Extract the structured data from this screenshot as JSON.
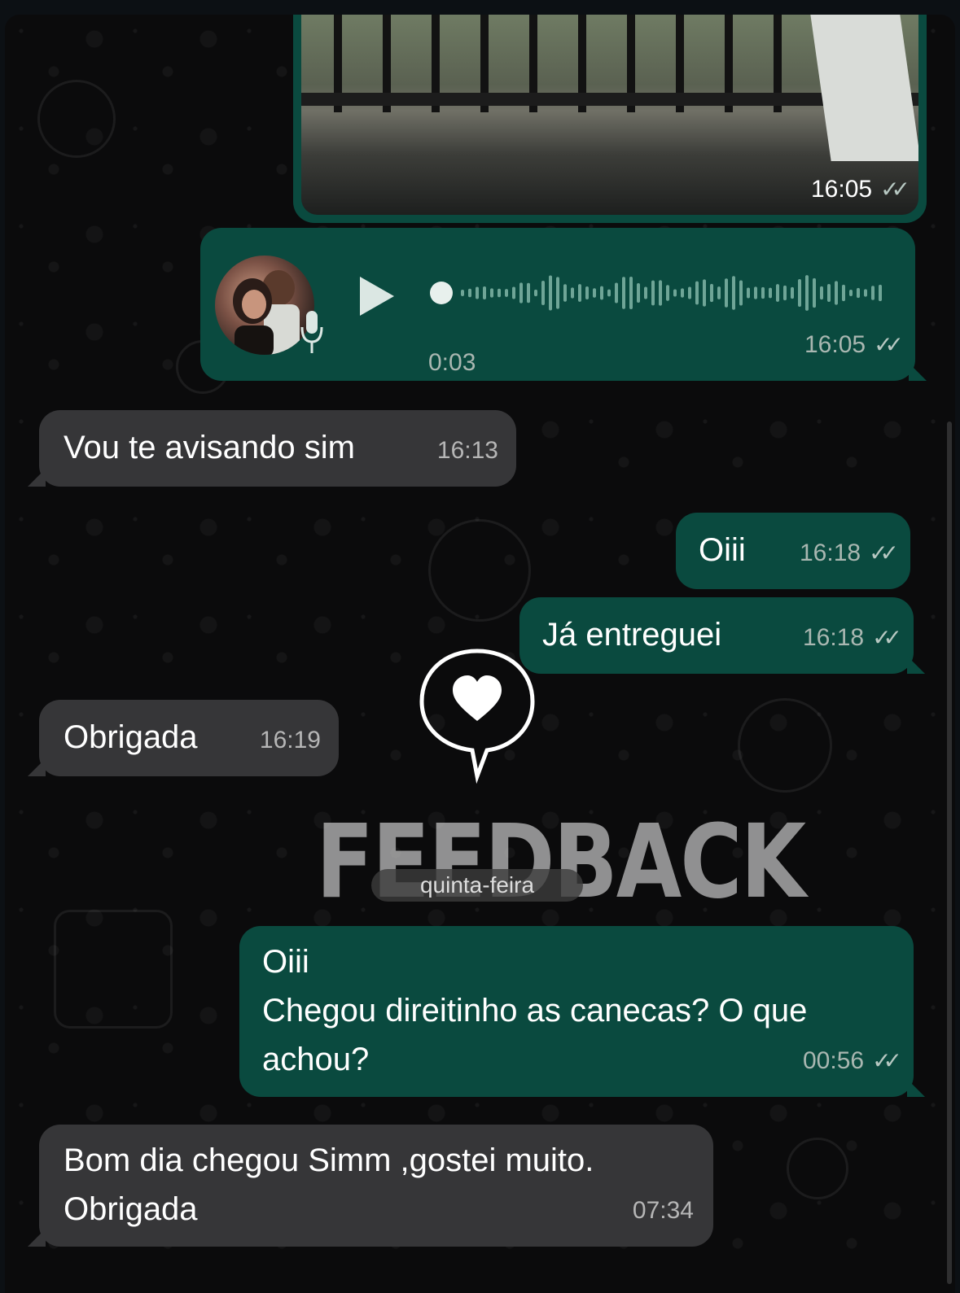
{
  "messages": [
    {
      "id": "photo",
      "type": "image",
      "time": "16:05",
      "ticks": "✓✓"
    },
    {
      "id": "audio",
      "type": "voice",
      "duration": "0:03",
      "time": "16:05",
      "ticks": "✓✓"
    },
    {
      "id": "m1",
      "direction": "in",
      "text": "Vou te avisando sim",
      "time": "16:13"
    },
    {
      "id": "m2",
      "direction": "out",
      "text": "Oiii",
      "time": "16:18",
      "ticks": "✓✓"
    },
    {
      "id": "m3",
      "direction": "out",
      "text": "Já entreguei",
      "time": "16:18",
      "ticks": "✓✓"
    },
    {
      "id": "m4",
      "direction": "in",
      "text": "Obrigada",
      "time": "16:19"
    },
    {
      "id": "m5",
      "direction": "out",
      "lines": [
        "Oiii",
        "Chegou direitinho as canecas? O que",
        "achou?"
      ],
      "time": "00:56",
      "ticks": "✓✓"
    },
    {
      "id": "m6",
      "direction": "in",
      "lines": [
        "Bom dia chegou Simm ,gostei muito.",
        "Obrigada"
      ],
      "time": "07:34"
    }
  ],
  "overlay": {
    "watermark": "FEEDBACK",
    "date_chip": "quinta-feira"
  },
  "colors": {
    "outgoing_bubble": "#0a4a3f",
    "incoming_bubble": "#363638",
    "background": "#0b0b0c"
  },
  "icons": [
    "play-icon",
    "mic-icon",
    "double-check-icon",
    "heart-speech-icon"
  ]
}
